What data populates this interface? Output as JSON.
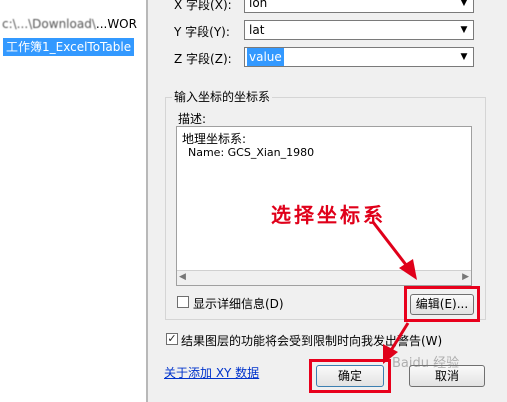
{
  "left_pane": {
    "path_text": "...WOR",
    "path_blurred": "c:\\...\\Download\\",
    "tree_item": "工作簿1_ExcelToTable"
  },
  "dialog": {
    "x_field": {
      "label": "X 字段(X):",
      "value": "lon"
    },
    "y_field": {
      "label": "Y 字段(Y):",
      "value": "lat"
    },
    "z_field": {
      "label": "Z 字段(Z):",
      "value": "value"
    },
    "group_title": "输入坐标的坐标系",
    "description_label": "描述:",
    "description_lines": [
      "地理坐标系:",
      "Name: GCS_Xian_1980"
    ],
    "show_details_label": "显示详细信息(D)",
    "edit_button": "编辑(E)...",
    "warning_label": "结果图层的功能将会受到限制时向我发出警告(W)",
    "about_link": "关于添加 XY 数据",
    "ok_button": "确定",
    "cancel_button": "取消"
  },
  "annotation": {
    "text": "选择坐标系",
    "color": "#e0001a"
  },
  "watermark": "Baidu 经验",
  "colors": {
    "highlight": "#3399ff",
    "red": "#e8001c",
    "dialog_bg": "#f0f0f0"
  }
}
